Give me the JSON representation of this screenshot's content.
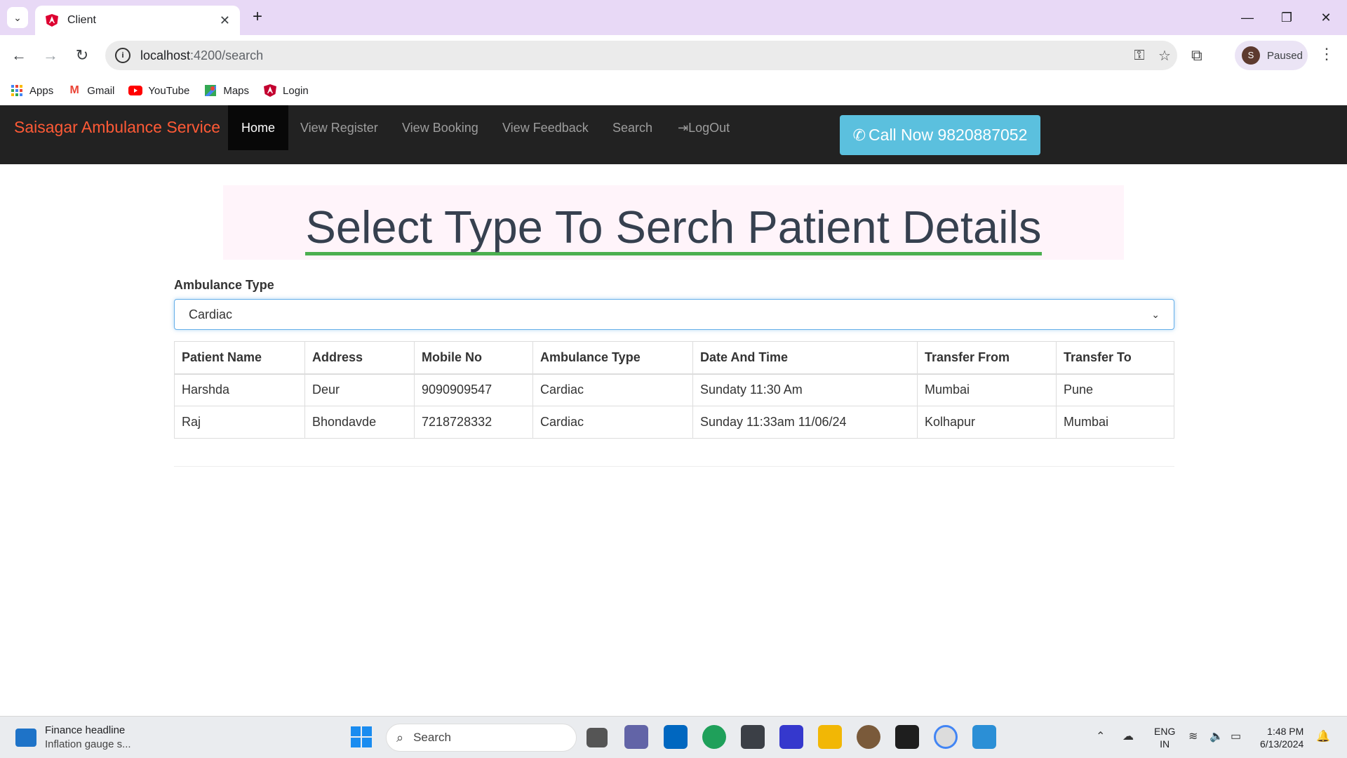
{
  "browser": {
    "tab_title": "Client",
    "url_host": "localhost",
    "url_path": ":4200/search",
    "profile_label": "Paused",
    "profile_initial": "S"
  },
  "bookmarks": [
    {
      "label": "Apps",
      "icon": "apps-grid-icon"
    },
    {
      "label": "Gmail",
      "icon": "gmail-icon"
    },
    {
      "label": "YouTube",
      "icon": "youtube-icon"
    },
    {
      "label": "Maps",
      "icon": "maps-icon"
    },
    {
      "label": "Login",
      "icon": "angular-icon"
    }
  ],
  "navbar": {
    "brand": "Saisagar Ambulance Service",
    "links": [
      "Home",
      "View Register",
      "View Booking",
      "View Feedback",
      "Search",
      "LogOut"
    ],
    "active": "Home",
    "call_button": "Call Now 9820887052"
  },
  "page": {
    "heading": "Select Type To Serch Patient Details",
    "filter_label": "Ambulance Type",
    "filter_value": "Cardiac"
  },
  "table": {
    "headers": [
      "Patient Name",
      "Address",
      "Mobile No",
      "Ambulance Type",
      "Date And Time",
      "Transfer From",
      "Transfer To"
    ],
    "rows": [
      [
        "Harshda",
        "Deur",
        "9090909547",
        "Cardiac",
        "Sundaty 11:30 Am",
        "Mumbai",
        "Pune"
      ],
      [
        "Raj",
        "Bhondavde",
        "7218728332",
        "Cardiac",
        "Sunday 11:33am 11/06/24",
        "Kolhapur",
        "Mumbai"
      ]
    ]
  },
  "taskbar": {
    "widget_title": "Finance headline",
    "widget_sub": "Inflation gauge s...",
    "search_placeholder": "Search",
    "lang_top": "ENG",
    "lang_bottom": "IN",
    "time": "1:48 PM",
    "date": "6/13/2024"
  },
  "colors": {
    "brand": "#ff5a36",
    "navbar_bg": "#222222",
    "call_button": "#5bc0de",
    "heading_underline": "#4caf50",
    "heading_box": "#fff4fa",
    "tabbar": "#e8d9f6"
  }
}
